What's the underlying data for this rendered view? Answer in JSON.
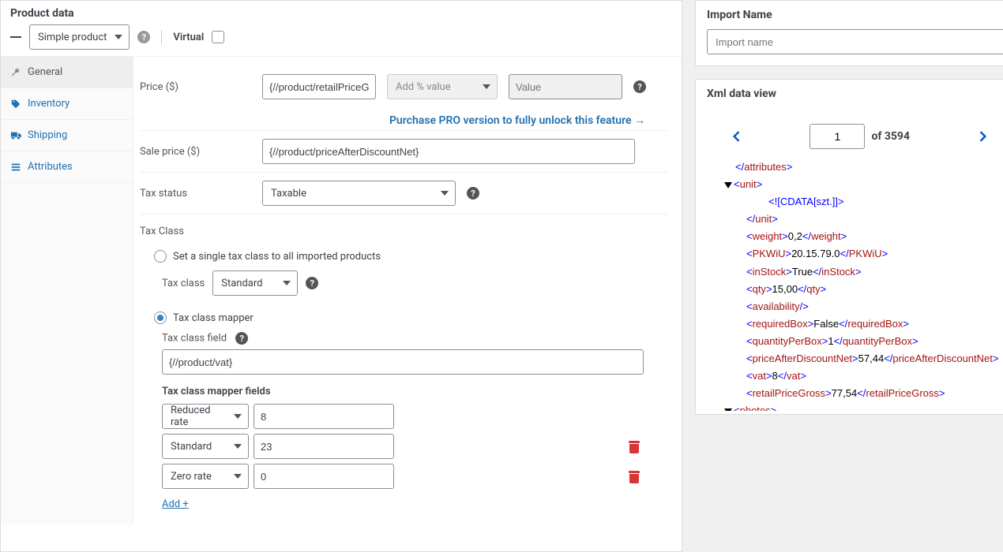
{
  "header": {
    "title": "Product data",
    "product_type": "Simple product",
    "virtual_label": "Virtual"
  },
  "tabs": [
    {
      "id": "general",
      "label": "General"
    },
    {
      "id": "inventory",
      "label": "Inventory"
    },
    {
      "id": "shipping",
      "label": "Shipping"
    },
    {
      "id": "attributes",
      "label": "Attributes"
    }
  ],
  "fields": {
    "price_label": "Price ($)",
    "price_value": "{//product/retailPriceGross}",
    "price_pct_placeholder": "Add % value",
    "price_val_placeholder": "Value",
    "pro_text": "Purchase PRO version to fully unlock this feature →",
    "sale_label": "Sale price ($)",
    "sale_value": "{//product/priceAfterDiscountNet}",
    "tax_status_label": "Tax status",
    "tax_status_value": "Taxable",
    "tax_class_heading": "Tax Class",
    "radio_single": "Set a single tax class to all imported products",
    "tax_class_label": "Tax class",
    "tax_class_value": "Standard",
    "radio_mapper": "Tax class mapper",
    "tax_class_field_label": "Tax class field",
    "tax_class_field_value": "{//product/vat}",
    "mapper_fields_label": "Tax class mapper fields",
    "mapper": [
      {
        "cls": "Reduced rate",
        "val": "8",
        "del": false
      },
      {
        "cls": "Standard",
        "val": "23",
        "del": true
      },
      {
        "cls": "Zero rate",
        "val": "0",
        "del": true
      }
    ],
    "add_label": "Add +"
  },
  "side": {
    "import_name_label": "Import Name",
    "import_name_placeholder": "Import name",
    "xml_view_label": "Xml data view",
    "page": "1",
    "total": "of 3594"
  },
  "xml": {
    "attributes_close": "attributes",
    "unit": "unit",
    "unit_cdata": "<![CDATA[szt.]]>",
    "weight": {
      "tag": "weight",
      "val": "0,2"
    },
    "pkwiu": {
      "tag": "PKWiU",
      "val": "20.15.79.0"
    },
    "instock": {
      "tag": "inStock",
      "val": "True"
    },
    "qty": {
      "tag": "qty",
      "val": "15,00"
    },
    "availability": "availability",
    "reqbox": {
      "tag": "requiredBox",
      "val": "False"
    },
    "qpb": {
      "tag": "quantityPerBox",
      "val": "1"
    },
    "padn": {
      "tag": "priceAfterDiscountNet",
      "val": "57,44"
    },
    "vat": {
      "tag": "vat",
      "val": "8"
    },
    "rpg": {
      "tag": "retailPriceGross",
      "val": "77,54"
    },
    "photos": "photos"
  }
}
